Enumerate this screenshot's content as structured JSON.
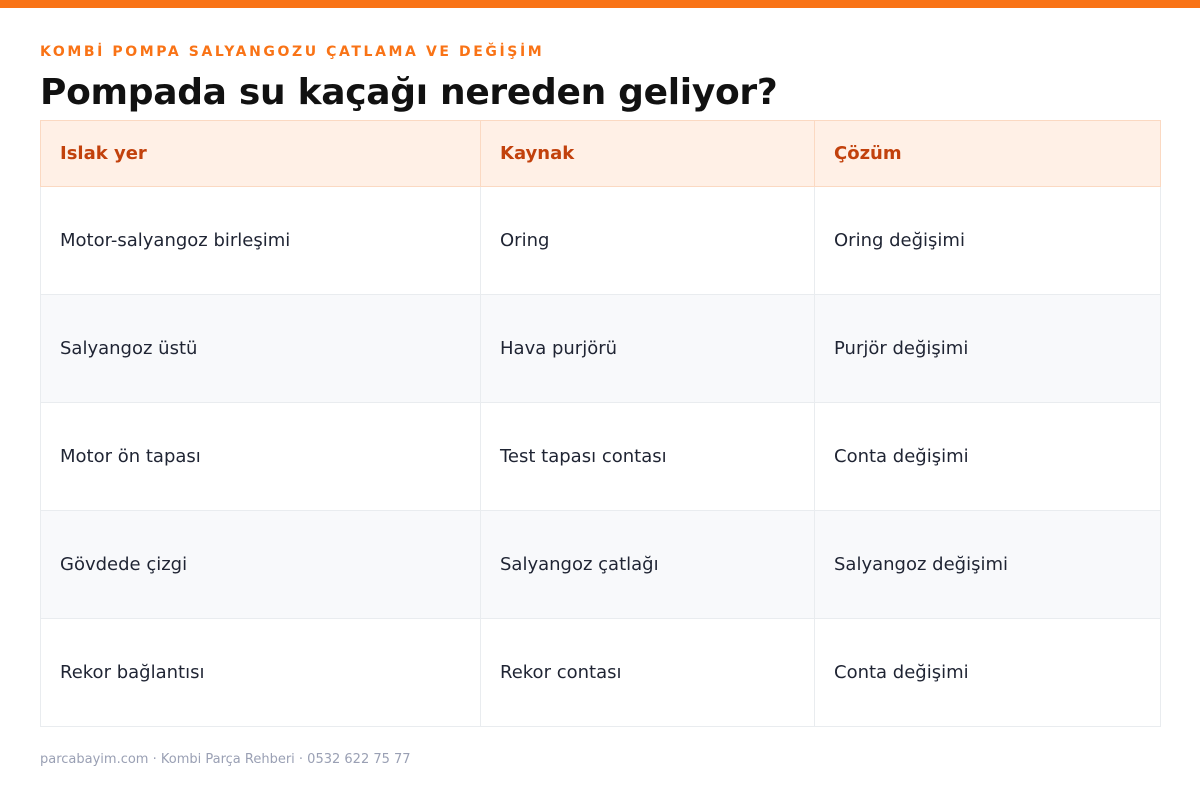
{
  "colors": {
    "accent": "#f97316",
    "header_bg": "#fff0e6",
    "header_text": "#c2410c"
  },
  "kicker": "KOMBİ POMPA SALYANGOZU ÇATLAMA VE DEĞİŞİM",
  "title": "Pompada su kaçağı nereden geliyor?",
  "table": {
    "headers": [
      "Islak yer",
      "Kaynak",
      "Çözüm"
    ],
    "rows": [
      [
        "Motor-salyangoz birleşimi",
        "Oring",
        "Oring değişimi"
      ],
      [
        "Salyangoz üstü",
        "Hava purjörü",
        "Purjör değişimi"
      ],
      [
        "Motor ön tapası",
        "Test tapası contası",
        "Conta değişimi"
      ],
      [
        "Gövdede çizgi",
        "Salyangoz çatlağı",
        "Salyangoz değişimi"
      ],
      [
        "Rekor bağlantısı",
        "Rekor contası",
        "Conta değişimi"
      ]
    ]
  },
  "footer": "parcabayim.com · Kombi Parça Rehberi · 0532 622 75 77"
}
